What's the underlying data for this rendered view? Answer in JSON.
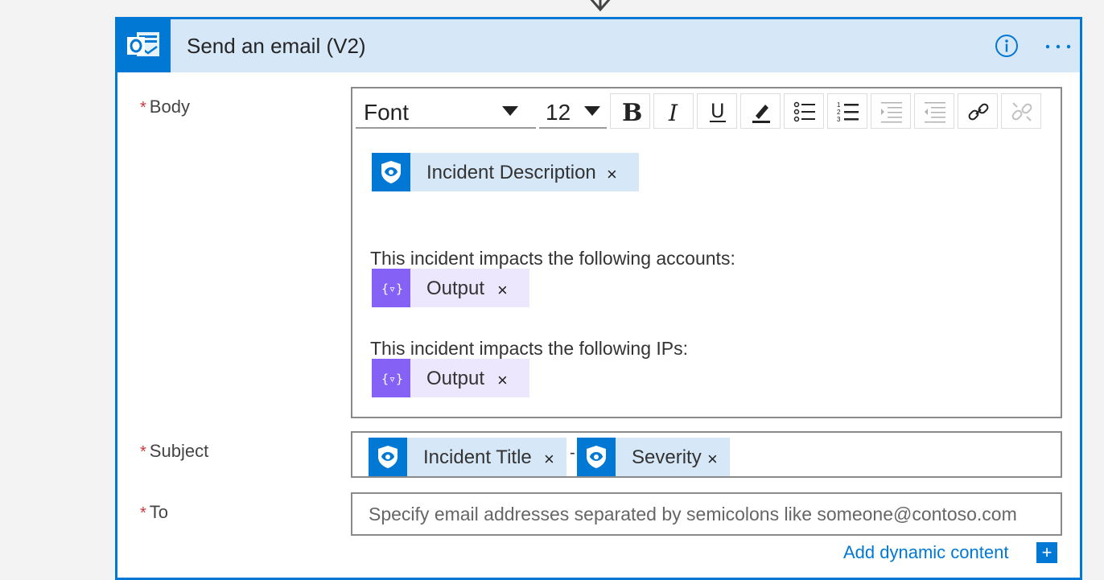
{
  "card": {
    "title": "Send an email (V2)",
    "app_icon": "outlook-icon",
    "header_color": "#d6e7f7",
    "accent": "#0078d4"
  },
  "body_field": {
    "label": "Body",
    "required_marker": "*",
    "toolbar": {
      "font_label": "Font",
      "size_label": "12",
      "buttons": [
        "bold-icon",
        "italic-icon",
        "underline-icon",
        "highlight-pen-icon",
        "bullet-list-icon",
        "numbered-list-icon",
        "indent-icon",
        "outdent-icon",
        "link-icon",
        "unlink-icon"
      ]
    },
    "content": {
      "token_incident_description": "Incident Description",
      "line_accounts": "This incident impacts the following accounts:",
      "token_output_1": "Output",
      "line_ips": "This incident impacts the following IPs:",
      "token_output_2": "Output",
      "close_glyph": "×"
    }
  },
  "subject_field": {
    "label": "Subject",
    "required_marker": "*",
    "token_incident_title": "Incident Title",
    "separator": "-",
    "token_severity": "Severity",
    "close_glyph": "×"
  },
  "to_field": {
    "label": "To",
    "required_marker": "*",
    "placeholder": "Specify email addresses separated by semicolons like someone@contoso.com",
    "add_dynamic_content": "Add dynamic content"
  },
  "colors": {
    "sentinel_token_bg": "#d6e7f7",
    "sentinel_icon_bg": "#0078d4",
    "variable_token_bg": "#ede7fd",
    "variable_icon_bg": "#8661f5",
    "required": "#d13438"
  }
}
